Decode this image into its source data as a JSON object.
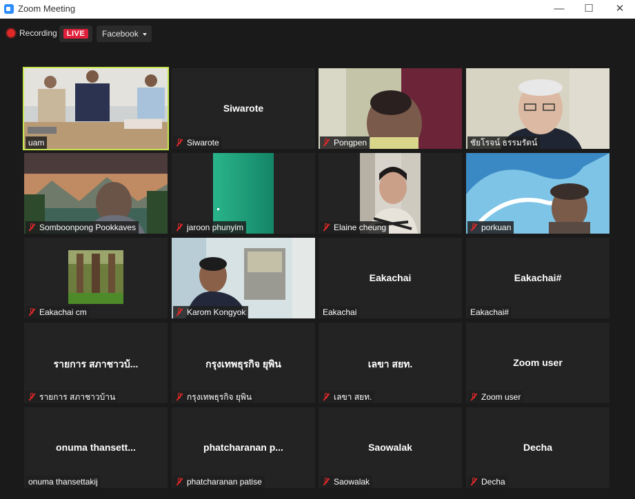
{
  "window": {
    "title": "Zoom Meeting",
    "minimize": "—",
    "maximize": "☐",
    "close": "✕"
  },
  "topbar": {
    "recording": "Recording",
    "live": "LIVE",
    "platform": "Facebook"
  },
  "colors": {
    "active_border": "#c6e84d",
    "live_badge": "#e0203a",
    "mute_icon": "#e02828",
    "background": "#1a1a1a",
    "tile": "#232323"
  },
  "participants": [
    {
      "name": "uam",
      "muted": false,
      "video": "meeting-room",
      "active": true
    },
    {
      "name": "Siwarote",
      "center": "Siwarote",
      "muted": true
    },
    {
      "name": "Pongpen",
      "muted": true,
      "video": "woman-curtain"
    },
    {
      "name": "ชัยโรจน์ ธรรมรัตน์",
      "muted": false,
      "video": "elderly-man"
    },
    {
      "name": "Somboonpong Pookkaves",
      "muted": true,
      "video": "mountain-lake"
    },
    {
      "name": "jaroon phunyim",
      "muted": true,
      "video": "green-screen"
    },
    {
      "name": "Elaine cheung",
      "muted": true,
      "video": "woman-office"
    },
    {
      "name": "porkuan",
      "muted": true,
      "video": "wave"
    },
    {
      "name": "Eakachai cm",
      "muted": true,
      "video": "rubber-trees"
    },
    {
      "name": "Karom Kongyok",
      "muted": true,
      "video": "man-desk"
    },
    {
      "name": "Eakachai",
      "center": "Eakachai",
      "muted": false
    },
    {
      "name": "Eakachai#",
      "center": "Eakachai#",
      "muted": false
    },
    {
      "name": "รายการ สภาชาวบ้าน",
      "center": "รายการ สภาชาวบ้...",
      "muted": true
    },
    {
      "name": "กรุงเทพธุรกิจ  ยุพิน",
      "center": "กรุงเทพธุรกิจ  ยุพิน",
      "muted": true
    },
    {
      "name": "เลขา สยท.",
      "center": "เลขา สยท.",
      "muted": true
    },
    {
      "name": "Zoom user",
      "center": "Zoom user",
      "muted": true
    },
    {
      "name": "onuma thansettakij",
      "center": "onuma  thansett...",
      "muted": false
    },
    {
      "name": "phatcharanan patise",
      "center": "phatcharanan  p...",
      "muted": true
    },
    {
      "name": "Saowalak",
      "center": "Saowalak",
      "muted": true
    },
    {
      "name": "Decha",
      "center": "Decha",
      "muted": true
    }
  ]
}
